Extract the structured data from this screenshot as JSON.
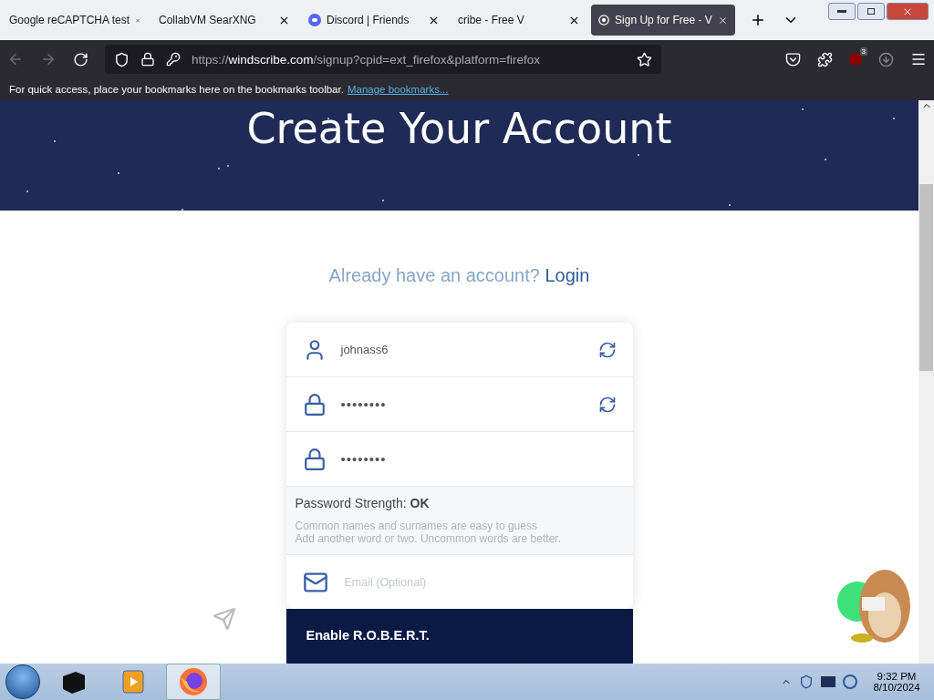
{
  "browser": {
    "tabs": [
      {
        "label": "Google reCAPTCHA test",
        "kind": "plain",
        "selected": false
      },
      {
        "label": "CollabVM SearXNG",
        "kind": "plain",
        "selected": false
      },
      {
        "label": "Discord | Friends",
        "kind": "discord",
        "selected": false
      },
      {
        "label": "cribe - Free V",
        "kind": "plain",
        "selected": false
      },
      {
        "label": "Sign Up for Free - V",
        "kind": "windscribe",
        "selected": true
      }
    ],
    "url": {
      "scheme": "https://",
      "host": "windscribe.com",
      "path": "/signup?cpid=ext_firefox&platform=firefox"
    },
    "extension_badge": "3",
    "bookmarks_bar": {
      "text": "For quick access, place your bookmarks here on the bookmarks toolbar.",
      "link": "Manage bookmarks..."
    }
  },
  "page": {
    "heading": "Create Your Account",
    "login_prompt": {
      "text": "Already have an account?",
      "link": "Login"
    },
    "fields": [
      {
        "kind": "username",
        "value": "johnass6",
        "refresh": true
      },
      {
        "kind": "password",
        "value": "••••••••",
        "refresh": true
      },
      {
        "kind": "password",
        "value": "••••••••",
        "refresh": false
      }
    ],
    "strength": {
      "label": "Password Strength:",
      "value": "OK",
      "hints": [
        "Common names and surnames are easy to guess",
        "Add another word or two. Uncommon words are better."
      ]
    },
    "email": {
      "placeholder": "Email (Optional)"
    },
    "robert": {
      "title": "Enable R.O.B.E.R.T."
    }
  },
  "taskbar": {
    "apps": [
      {
        "kind": "terminal",
        "selected": false
      },
      {
        "kind": "media",
        "selected": false
      },
      {
        "kind": "firefox",
        "selected": true
      }
    ],
    "time": "9:32 PM",
    "date": "8/10/2024"
  }
}
